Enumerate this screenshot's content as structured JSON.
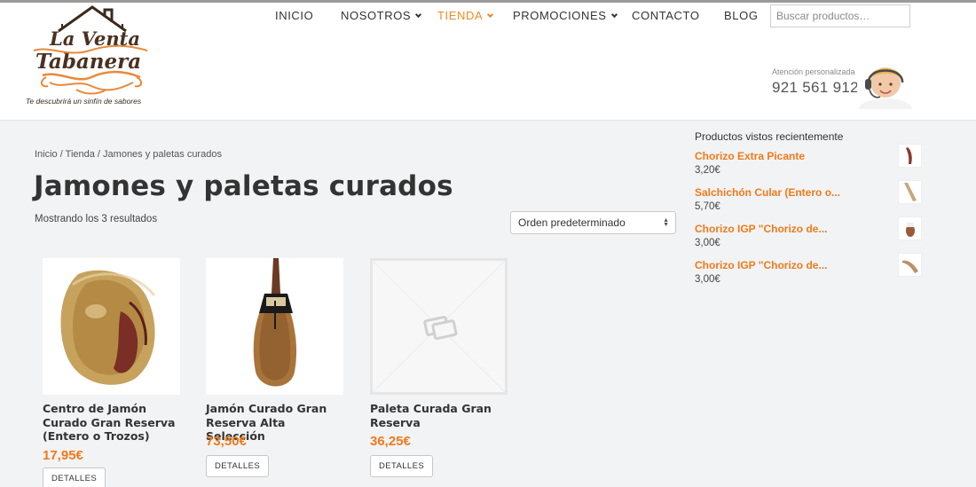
{
  "header": {
    "logo_text": "La Venta Tabanera",
    "tagline": "Te descubrirá un sinfín de sabores",
    "nav": [
      {
        "label": "INICIO"
      },
      {
        "label": "NOSOTROS"
      },
      {
        "label": "TIENDA"
      },
      {
        "label": "PROMOCIONES"
      },
      {
        "label": "CONTACTO"
      },
      {
        "label": "BLOG"
      }
    ],
    "search_placeholder": "Buscar productos…",
    "support_label": "Atención personalizada",
    "support_phone": "921 561 912"
  },
  "main": {
    "breadcrumb": "Inicio / Tienda / Jamones y paletas curados",
    "title": "Jamones y paletas curados",
    "result_count": "Mostrando los 3 resultados",
    "orderby": "Orden predeterminado",
    "products": [
      {
        "name": "Centro de Jamón Curado Gran Reserva (Entero o Trozos)",
        "price": "17,95€",
        "button": "DETALLES"
      },
      {
        "name": "Jamón Curado Gran Reserva Alta Selección",
        "price": "73,50€",
        "button": "DETALLES"
      },
      {
        "name": "Paleta Curada Gran Reserva",
        "price": "36,25€",
        "button": "DETALLES"
      }
    ]
  },
  "sidebar": {
    "recent_title": "Productos vistos recientemente",
    "recent": [
      {
        "name": "Chorizo Extra Picante",
        "price": "3,20€"
      },
      {
        "name": "Salchichón Cular (Entero o...",
        "price": "5,70€"
      },
      {
        "name": "Chorizo IGP \"Chorizo de...",
        "price": "3,00€"
      },
      {
        "name": "Chorizo IGP \"Chorizo de...",
        "price": "3,00€"
      }
    ]
  },
  "colors": {
    "accent": "#f07a1a",
    "nav_active": "#f08a24",
    "logo_brown": "#4a3020",
    "logo_orange": "#e98a3a"
  },
  "icons": {
    "placeholder": "image-placeholder-icon",
    "search": "search-field",
    "support": "support-agent-photo"
  }
}
